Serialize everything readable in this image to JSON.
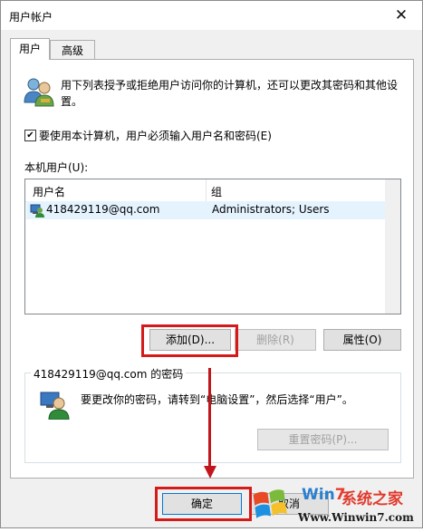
{
  "window": {
    "title": "用户帐户",
    "close_symbol": "✕"
  },
  "tabs": [
    {
      "label": "用户",
      "active": true
    },
    {
      "label": "高级",
      "active": false
    }
  ],
  "description": "用下列表授予或拒绝用户访问你的计算机，还可以更改其密码和其他设置。",
  "require_login": {
    "checked": true,
    "check_symbol": "✔",
    "label": "要使用本计算机，用户必须输入用户名和密码(E)"
  },
  "users_section": {
    "label": "本机用户(U):",
    "columns": [
      "用户名",
      "组"
    ],
    "rows": [
      {
        "username": "418429119@qq.com",
        "group": "Administrators; Users"
      }
    ]
  },
  "buttons": {
    "add": "添加(D)...",
    "remove": "删除(R)",
    "properties": "属性(O)",
    "reset_password": "重置密码(P)...",
    "ok": "确定",
    "cancel": "取消"
  },
  "password_group": {
    "title": "418429119@qq.com 的密码",
    "info": "要更改你的密码，请转到“电脑设置”，然后选择“用户”。"
  },
  "watermark": {
    "brand_a": "Win",
    "brand_b": "7",
    "brand_cn": "系统之家",
    "url": "Www.Winwin7.com"
  },
  "colors": {
    "annotation_red": "#d51a1a",
    "selection_bg": "#e5f3ff",
    "window_bg": "#f0f0f0"
  }
}
